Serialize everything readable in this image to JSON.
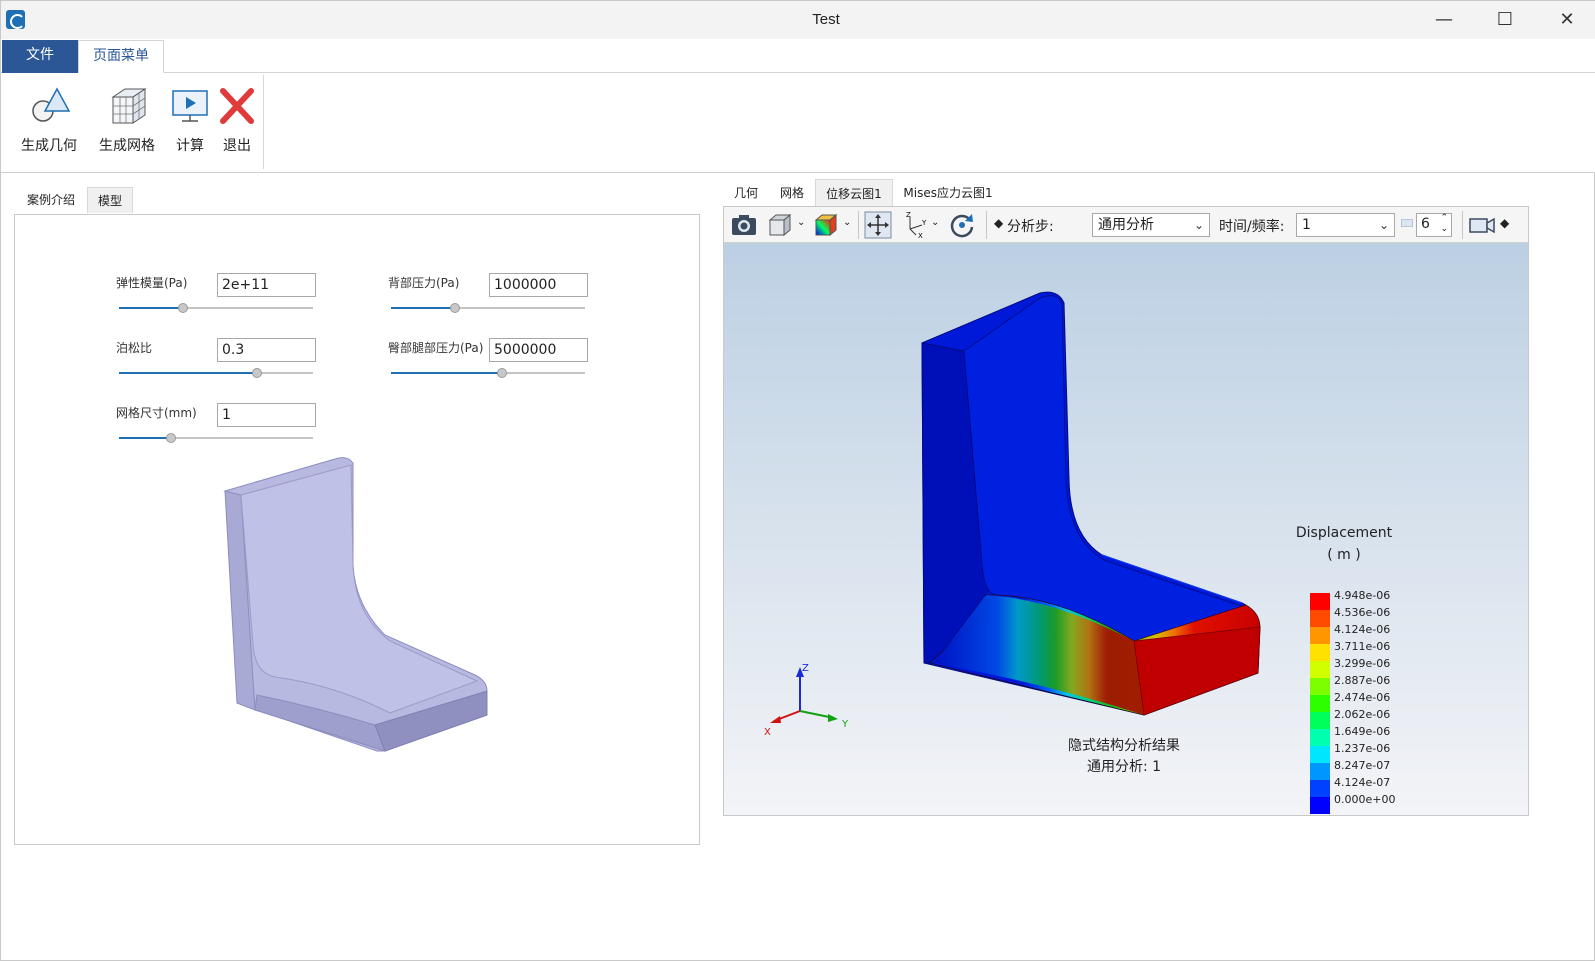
{
  "window": {
    "title": "Test"
  },
  "menu_tabs": {
    "file": "文件",
    "page_menu": "页面菜单"
  },
  "ribbon": {
    "gen_geometry": "生成几何",
    "gen_mesh": "生成网格",
    "compute": "计算",
    "exit": "退出"
  },
  "left": {
    "tabs": {
      "intro": "案例介绍",
      "model": "模型"
    },
    "params": {
      "elastic_modulus": {
        "label": "弹性模量(Pa)",
        "value": "2e+11",
        "slider": 0.33
      },
      "back_pressure": {
        "label": "背部压力(Pa)",
        "value": "1000000",
        "slider": 0.33
      },
      "poisson": {
        "label": "泊松比",
        "value": "0.3",
        "slider": 0.71
      },
      "hip_leg_pressure": {
        "label": "臀部腿部压力(Pa)",
        "value": "5000000",
        "slider": 0.57
      },
      "mesh_size": {
        "label": "网格尺寸(mm)",
        "value": "1",
        "slider": 0.27
      }
    }
  },
  "right": {
    "tabs": {
      "geometry": "几何",
      "mesh": "网格",
      "disp_contour": "位移云图1",
      "mises_contour": "Mises应力云图1"
    },
    "toolbar": {
      "step_label": "分析步:",
      "step_value": "通用分析",
      "time_label": "时间/频率:",
      "time_value": "1",
      "spin_value": "6"
    },
    "legend": {
      "title": "Displacement",
      "unit": "( m )",
      "labels": [
        "4.948e-06",
        "4.536e-06",
        "4.124e-06",
        "3.711e-06",
        "3.299e-06",
        "2.887e-06",
        "2.474e-06",
        "2.062e-06",
        "1.649e-06",
        "1.237e-06",
        "8.247e-07",
        "4.124e-07",
        "0.000e+00"
      ],
      "colors": [
        "#ff0000",
        "#ff4a00",
        "#ff9600",
        "#ffe100",
        "#d2ff00",
        "#7dff00",
        "#2dff00",
        "#00ff5a",
        "#00ffaf",
        "#00e6ff",
        "#0096ff",
        "#0041ff",
        "#0000ff"
      ]
    },
    "result": {
      "line1": "隐式结构分析结果",
      "line2": "通用分析: 1"
    },
    "axes": {
      "x": "X",
      "y": "Y",
      "z": "Z"
    }
  }
}
